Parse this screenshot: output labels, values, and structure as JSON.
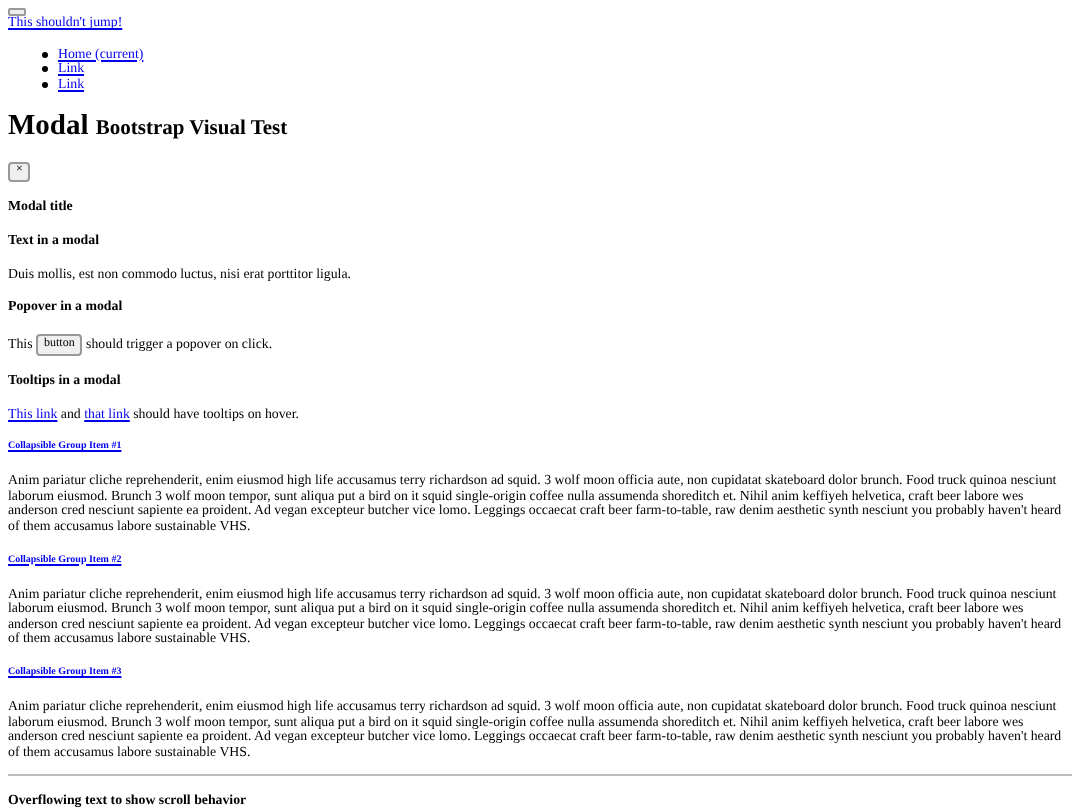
{
  "navbar": {
    "toggle_button": true,
    "brand": "This shouldn't jump!",
    "links": [
      "Home (current)",
      "Link",
      "Link"
    ]
  },
  "page_heading": {
    "title": "Modal",
    "subtitle": "Bootstrap Visual Test"
  },
  "modal": {
    "close": "×",
    "title": "Modal title",
    "sections": [
      {
        "kind": "text",
        "heading": "Text in a modal",
        "text": "Duis mollis, est non commodo luctus, nisi erat porttitor ligula."
      },
      {
        "kind": "popover",
        "heading": "Popover in a modal",
        "before": "This",
        "button": "button",
        "after": "should trigger a popover on click."
      },
      {
        "kind": "tooltips",
        "heading": "Tooltips in a modal",
        "link_1": "This link",
        "middle": "and",
        "link_2": "that link",
        "after": "should have tooltips on hover."
      }
    ],
    "collapsibles": [
      {
        "title": "Collapsible Group Item #1",
        "body": "Anim pariatur cliche reprehenderit, enim eiusmod high life accusamus terry richardson ad squid. 3 wolf moon officia aute, non cupidatat skateboard dolor brunch. Food truck quinoa nesciunt laborum eiusmod. Brunch 3 wolf moon tempor, sunt aliqua put a bird on it squid single-origin coffee nulla assumenda shoreditch et. Nihil anim keffiyeh helvetica, craft beer labore wes anderson cred nesciunt sapiente ea proident. Ad vegan excepteur butcher vice lomo. Leggings occaecat craft beer farm-to-table, raw denim aesthetic synth nesciunt you probably haven't heard of them accusamus labore sustainable VHS."
      },
      {
        "title": "Collapsible Group Item #2",
        "body": "Anim pariatur cliche reprehenderit, enim eiusmod high life accusamus terry richardson ad squid. 3 wolf moon officia aute, non cupidatat skateboard dolor brunch. Food truck quinoa nesciunt laborum eiusmod. Brunch 3 wolf moon tempor, sunt aliqua put a bird on it squid single-origin coffee nulla assumenda shoreditch et. Nihil anim keffiyeh helvetica, craft beer labore wes anderson cred nesciunt sapiente ea proident. Ad vegan excepteur butcher vice lomo. Leggings occaecat craft beer farm-to-table, raw denim aesthetic synth nesciunt you probably haven't heard of them accusamus labore sustainable VHS."
      },
      {
        "title": "Collapsible Group Item #3",
        "body": "Anim pariatur cliche reprehenderit, enim eiusmod high life accusamus terry richardson ad squid. 3 wolf moon officia aute, non cupidatat skateboard dolor brunch. Food truck quinoa nesciunt laborum eiusmod. Brunch 3 wolf moon tempor, sunt aliqua put a bird on it squid single-origin coffee nulla assumenda shoreditch et. Nihil anim keffiyeh helvetica, craft beer labore wes anderson cred nesciunt sapiente ea proident. Ad vegan excepteur butcher vice lomo. Leggings occaecat craft beer farm-to-table, raw denim aesthetic synth nesciunt you probably haven't heard of them accusamus labore sustainable VHS."
      }
    ],
    "overflow_heading": "Overflowing text to show scroll behavior"
  }
}
